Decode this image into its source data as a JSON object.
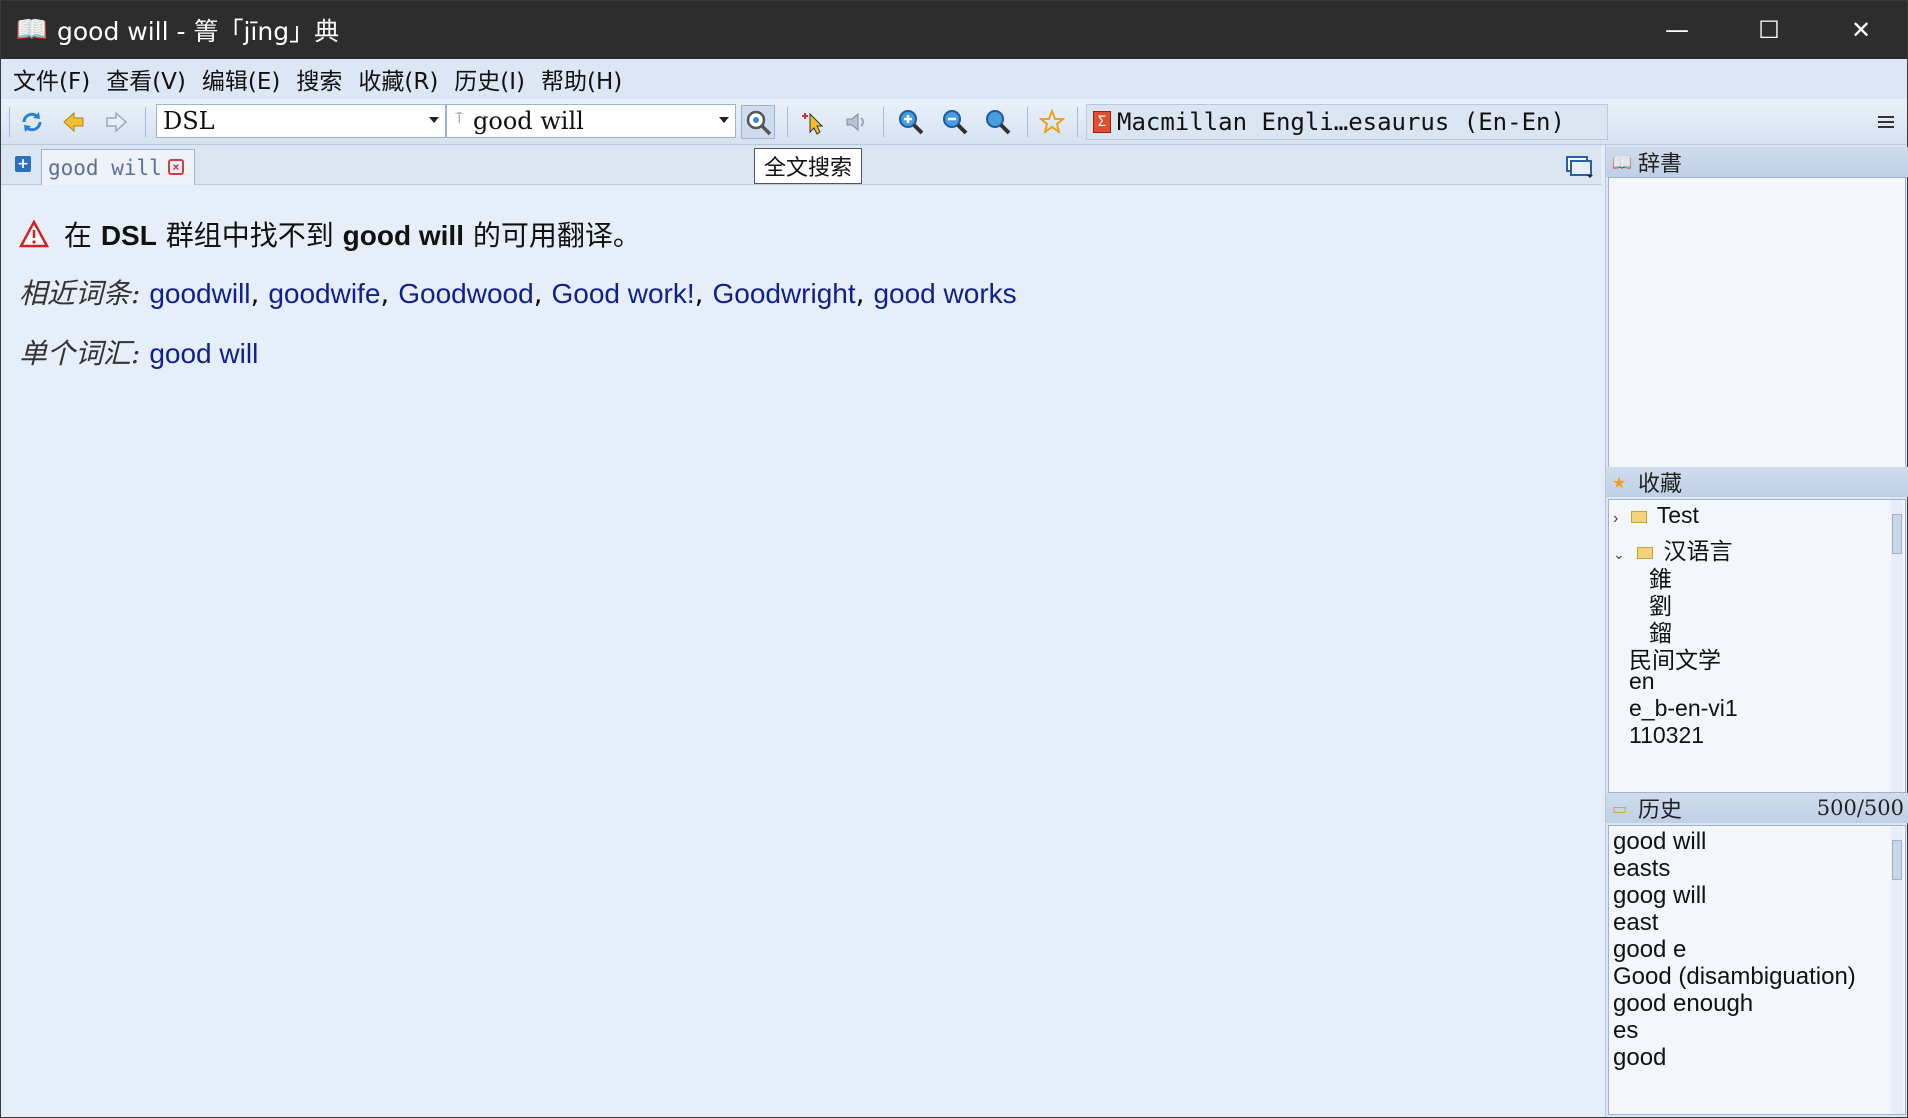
{
  "window": {
    "title": "good will - 箐「jīng」典",
    "minimize_glyph": "—",
    "maximize_glyph": "☐",
    "close_glyph": "✕"
  },
  "menu": {
    "items": [
      "文件(F)",
      "查看(V)",
      "编辑(E)",
      "搜索",
      "收藏(R)",
      "历史(I)",
      "帮助(H)"
    ]
  },
  "toolbar": {
    "group_value": "DSL",
    "search_value": "good will",
    "dictionary_label": "Macmillan Engli…esaurus (En-En)",
    "fulltext_tooltip": "全文搜索"
  },
  "tabs": [
    {
      "label": "good will"
    }
  ],
  "article": {
    "not_found_prefix": "在",
    "group_name": "DSL",
    "not_found_middle": "群组中找不到",
    "query": "good will",
    "not_found_suffix": "的可用翻译。",
    "similar_label": "相近词条:",
    "similar_words": [
      "goodwill",
      "goodwife",
      "Goodwood",
      "Good work!",
      "Goodwright",
      "good works"
    ],
    "single_label": "单个词汇:",
    "single_words": [
      "good will"
    ]
  },
  "panels": {
    "dictionaries_title": "辞書",
    "favorites_title": "收藏",
    "favorites": [
      {
        "label": "Test",
        "type": "folder",
        "expanded": false
      },
      {
        "label": "汉语言",
        "type": "folder",
        "expanded": true
      },
      {
        "label": "錐",
        "type": "item"
      },
      {
        "label": "劉",
        "type": "item"
      },
      {
        "label": "鎦",
        "type": "item"
      },
      {
        "label": "民间文学",
        "type": "item"
      },
      {
        "label": "en",
        "type": "item"
      },
      {
        "label": "e_b-en-vi1",
        "type": "item"
      },
      {
        "label": "110321",
        "type": "item"
      }
    ],
    "history_title": "历史",
    "history_count": "500/500",
    "history": [
      "good will",
      "easts",
      "goog will",
      "east",
      "good e",
      "Good (disambiguation)",
      "good enough",
      "es",
      "good"
    ]
  },
  "colors": {
    "link": "#0f1f8f",
    "titlebar": "#2d2d2d",
    "background": "#e6eef9"
  }
}
